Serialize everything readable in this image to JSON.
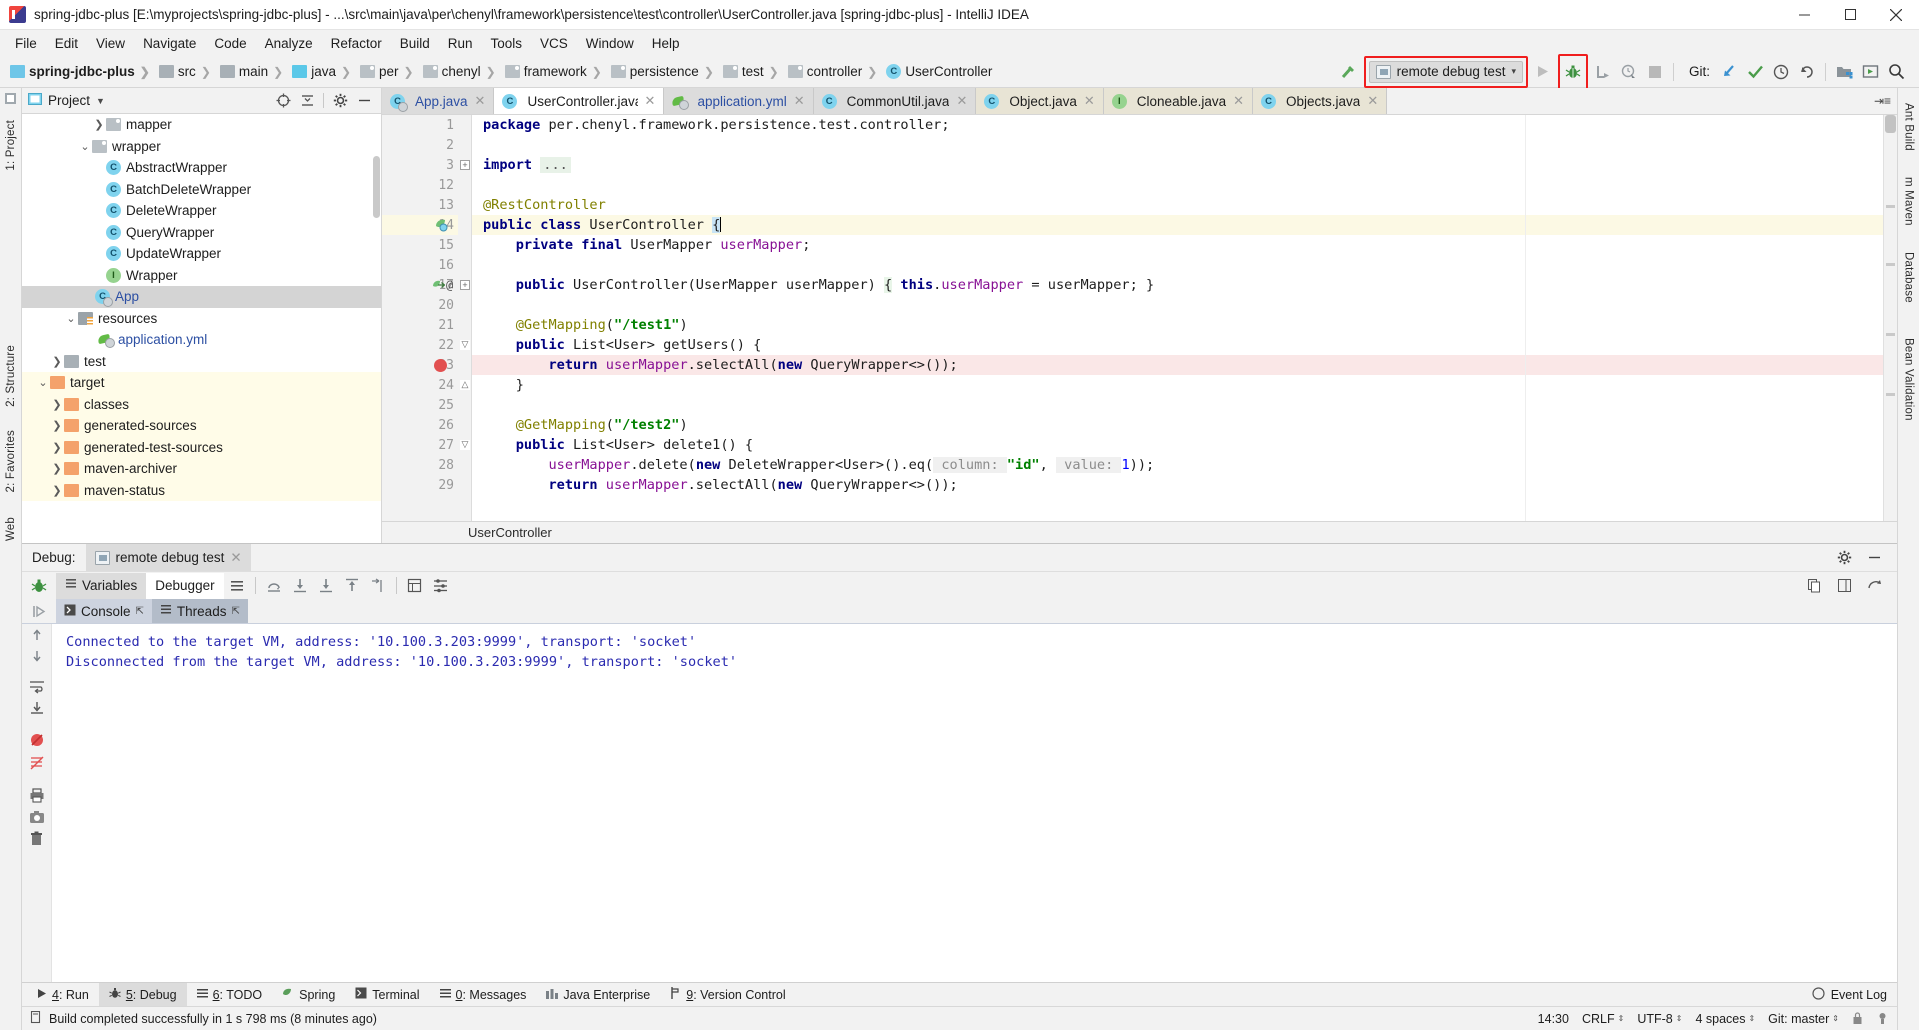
{
  "window": {
    "title": "spring-jdbc-plus [E:\\myprojects\\spring-jdbc-plus] - ...\\src\\main\\java\\per\\chenyl\\framework\\persistence\\test\\controller\\UserController.java [spring-jdbc-plus] - IntelliJ IDEA",
    "minimize": "–",
    "maximize": "□",
    "close": "✕"
  },
  "menu": [
    "File",
    "Edit",
    "View",
    "Navigate",
    "Code",
    "Analyze",
    "Refactor",
    "Build",
    "Run",
    "Tools",
    "VCS",
    "Window",
    "Help"
  ],
  "breadcrumbs": [
    {
      "label": "spring-jdbc-plus",
      "icon": "module-icon",
      "kind": "mod"
    },
    {
      "label": "src",
      "icon": "folder-icon",
      "kind": "gray"
    },
    {
      "label": "main",
      "icon": "folder-icon",
      "kind": "gray"
    },
    {
      "label": "java",
      "icon": "source-folder-icon",
      "kind": "cyan"
    },
    {
      "label": "per",
      "icon": "package-icon",
      "kind": "pkg"
    },
    {
      "label": "chenyl",
      "icon": "package-icon",
      "kind": "pkg"
    },
    {
      "label": "framework",
      "icon": "package-icon",
      "kind": "pkg"
    },
    {
      "label": "persistence",
      "icon": "package-icon",
      "kind": "pkg"
    },
    {
      "label": "test",
      "icon": "package-icon",
      "kind": "pkg"
    },
    {
      "label": "controller",
      "icon": "package-icon",
      "kind": "pkg"
    },
    {
      "label": "UserController",
      "icon": "class-icon",
      "kind": "class"
    }
  ],
  "toolbar": {
    "run_config": "remote debug test",
    "git_label": "Git:",
    "highlight_color": "#f01e1e"
  },
  "project": {
    "panel_title": "Project",
    "tree": [
      {
        "label": "mapper",
        "indent": 5,
        "arrow": "collapsed",
        "icon": "package-icon",
        "state": "normal"
      },
      {
        "label": "wrapper",
        "indent": 4,
        "arrow": "expanded",
        "icon": "package-icon",
        "state": "normal"
      },
      {
        "label": "AbstractWrapper",
        "indent": 6,
        "arrow": "none",
        "icon": "class-icon",
        "state": "normal"
      },
      {
        "label": "BatchDeleteWrapper",
        "indent": 6,
        "arrow": "none",
        "icon": "class-icon",
        "state": "normal"
      },
      {
        "label": "DeleteWrapper",
        "indent": 6,
        "arrow": "none",
        "icon": "class-icon",
        "state": "normal"
      },
      {
        "label": "QueryWrapper",
        "indent": 6,
        "arrow": "none",
        "icon": "class-icon",
        "state": "normal"
      },
      {
        "label": "UpdateWrapper",
        "indent": 6,
        "arrow": "none",
        "icon": "class-icon",
        "state": "normal"
      },
      {
        "label": "Wrapper",
        "indent": 6,
        "arrow": "none",
        "icon": "interface-icon",
        "state": "normal"
      },
      {
        "label": "App",
        "indent": 5,
        "arrow": "none",
        "icon": "runnable-class-icon",
        "state": "selected"
      },
      {
        "label": "resources",
        "indent": 3,
        "arrow": "expanded",
        "icon": "resource-folder-icon",
        "state": "normal"
      },
      {
        "label": "application.yml",
        "indent": 5,
        "arrow": "none",
        "icon": "yaml-icon",
        "state": "normal"
      },
      {
        "label": "test",
        "indent": 2,
        "arrow": "collapsed",
        "icon": "folder-icon",
        "state": "normal"
      },
      {
        "label": "target",
        "indent": 1,
        "arrow": "expanded",
        "icon": "excluded-folder-icon",
        "state": "excluded"
      },
      {
        "label": "classes",
        "indent": 2,
        "arrow": "collapsed",
        "icon": "excluded-folder-icon",
        "state": "excluded"
      },
      {
        "label": "generated-sources",
        "indent": 2,
        "arrow": "collapsed",
        "icon": "excluded-folder-icon",
        "state": "excluded"
      },
      {
        "label": "generated-test-sources",
        "indent": 2,
        "arrow": "collapsed",
        "icon": "excluded-folder-icon",
        "state": "excluded"
      },
      {
        "label": "maven-archiver",
        "indent": 2,
        "arrow": "collapsed",
        "icon": "excluded-folder-icon",
        "state": "excluded"
      },
      {
        "label": "maven-status",
        "indent": 2,
        "arrow": "collapsed",
        "icon": "excluded-folder-icon",
        "state": "excluded"
      }
    ]
  },
  "editor": {
    "tabs": [
      {
        "label": "App.java",
        "icon": "runnable-class-icon",
        "state": "inactive",
        "text_color": "blue"
      },
      {
        "label": "UserController.java",
        "icon": "class-icon",
        "state": "active",
        "text_color": "dark"
      },
      {
        "label": "application.yml",
        "icon": "yaml-icon",
        "state": "inactive",
        "text_color": "blue"
      },
      {
        "label": "CommonUtil.java",
        "icon": "class-icon",
        "state": "inactive",
        "text_color": "dark"
      },
      {
        "label": "Object.java",
        "icon": "class-icon-locked",
        "state": "library",
        "text_color": "dark"
      },
      {
        "label": "Cloneable.java",
        "icon": "interface-icon-locked",
        "state": "library",
        "text_color": "dark"
      },
      {
        "label": "Objects.java",
        "icon": "class-icon-locked",
        "state": "library",
        "text_color": "dark"
      }
    ],
    "line_numbers": [
      "1",
      "2",
      "3",
      "12",
      "13",
      "14",
      "15",
      "16",
      "17",
      "20",
      "21",
      "22",
      "23",
      "24",
      "25",
      "26",
      "27",
      "28",
      "29"
    ],
    "code_lines": [
      "package per.chenyl.framework.persistence.test.controller;",
      "",
      "import ...",
      "",
      "@RestController",
      "public class UserController {",
      "    private final UserMapper userMapper;",
      "",
      "    public UserController(UserMapper userMapper) { this.userMapper = userMapper; }",
      "",
      "    @GetMapping(\"/test1\")",
      "    public List<User> getUsers() {",
      "        return userMapper.selectAll(new QueryWrapper<>());",
      "    }",
      "",
      "    @GetMapping(\"/test2\")",
      "    public List<User> delete1() {",
      "        userMapper.delete(new DeleteWrapper<User>().eq( column: \"id\", value: 1));",
      "        return userMapper.selectAll(new QueryWrapper<>());"
    ],
    "breakpoint_line": "23",
    "caret_line": "14",
    "bottom_breadcrumb": "UserController"
  },
  "debug": {
    "header_label": "Debug:",
    "session_tab": "remote debug test",
    "tabs": [
      {
        "label": "Variables",
        "active": false
      },
      {
        "label": "Debugger",
        "active": true
      }
    ],
    "sub_tabs": [
      {
        "label": "Console",
        "active": true
      },
      {
        "label": "Threads",
        "active": false
      }
    ],
    "console_lines": [
      "Connected to the target VM, address: '10.100.3.203:9999', transport: 'socket'",
      "Disconnected from the target VM, address: '10.100.3.203:9999', transport: 'socket'"
    ]
  },
  "rails": {
    "left": [
      "1: Project",
      "2: Structure",
      "2: Favorites",
      "Web"
    ],
    "right": [
      "Ant Build",
      "m Maven",
      "Database",
      "Bean Validation"
    ]
  },
  "toolwindows": [
    {
      "num": "4",
      "label": ": Run",
      "icon": "run-icon",
      "active": false
    },
    {
      "num": "5",
      "label": ": Debug",
      "icon": "debug-icon",
      "active": true
    },
    {
      "num": "6",
      "label": ": TODO",
      "icon": "todo-icon",
      "active": false
    },
    {
      "num": "",
      "label": "Spring",
      "icon": "spring-icon",
      "active": false
    },
    {
      "num": "",
      "label": "Terminal",
      "icon": "terminal-icon",
      "active": false
    },
    {
      "num": "0",
      "label": ": Messages",
      "icon": "messages-icon",
      "active": false
    },
    {
      "num": "",
      "label": "Java Enterprise",
      "icon": "java-enterprise-icon",
      "active": false
    },
    {
      "num": "9",
      "label": ": Version Control",
      "icon": "version-control-icon",
      "active": false
    }
  ],
  "event_log": "Event Log",
  "status": {
    "message": "Build completed successfully in 1 s 798 ms (8 minutes ago)",
    "time": "14:30",
    "line_separator": "CRLF",
    "encoding": "UTF-8",
    "indent": "4 spaces",
    "git_branch": "Git: master"
  }
}
